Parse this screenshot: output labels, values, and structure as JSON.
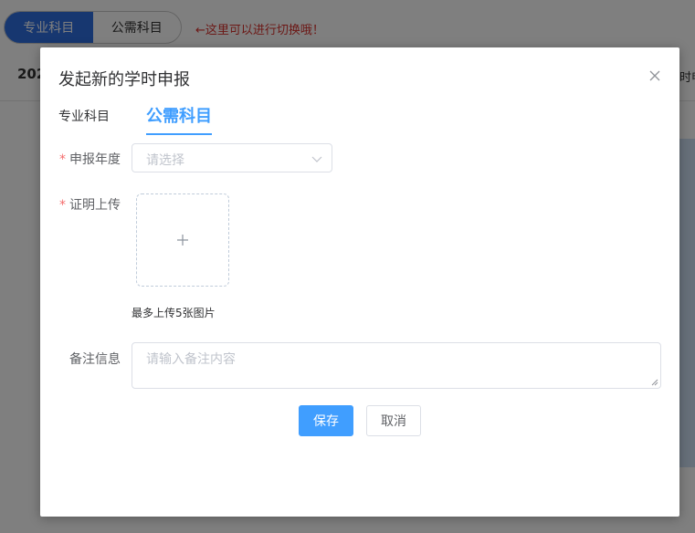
{
  "background": {
    "toggle": {
      "tab_professional": "专业科目",
      "tab_public": "公需科目"
    },
    "hint": "←这里可以进行切换哦！",
    "year_partial": "202",
    "right_partial": "时申"
  },
  "dialog": {
    "title": "发起新的学时申报",
    "tabs": [
      {
        "label": "专业科目"
      },
      {
        "label": "公需科目"
      }
    ],
    "form": {
      "year": {
        "label": "申报年度",
        "placeholder": "请选择"
      },
      "upload": {
        "label": "证明上传",
        "tip": "最多上传5张图片"
      },
      "note": {
        "label": "备注信息",
        "placeholder": "请输入备注内容"
      }
    },
    "buttons": {
      "save": "保存",
      "cancel": "取消"
    }
  },
  "colors": {
    "primary": "#409eff",
    "required": "#f56c6c",
    "hint": "#d9302c"
  },
  "icons": {
    "close": "close-icon",
    "select_arrow": "chevron-down-icon",
    "upload": "plus-icon"
  }
}
